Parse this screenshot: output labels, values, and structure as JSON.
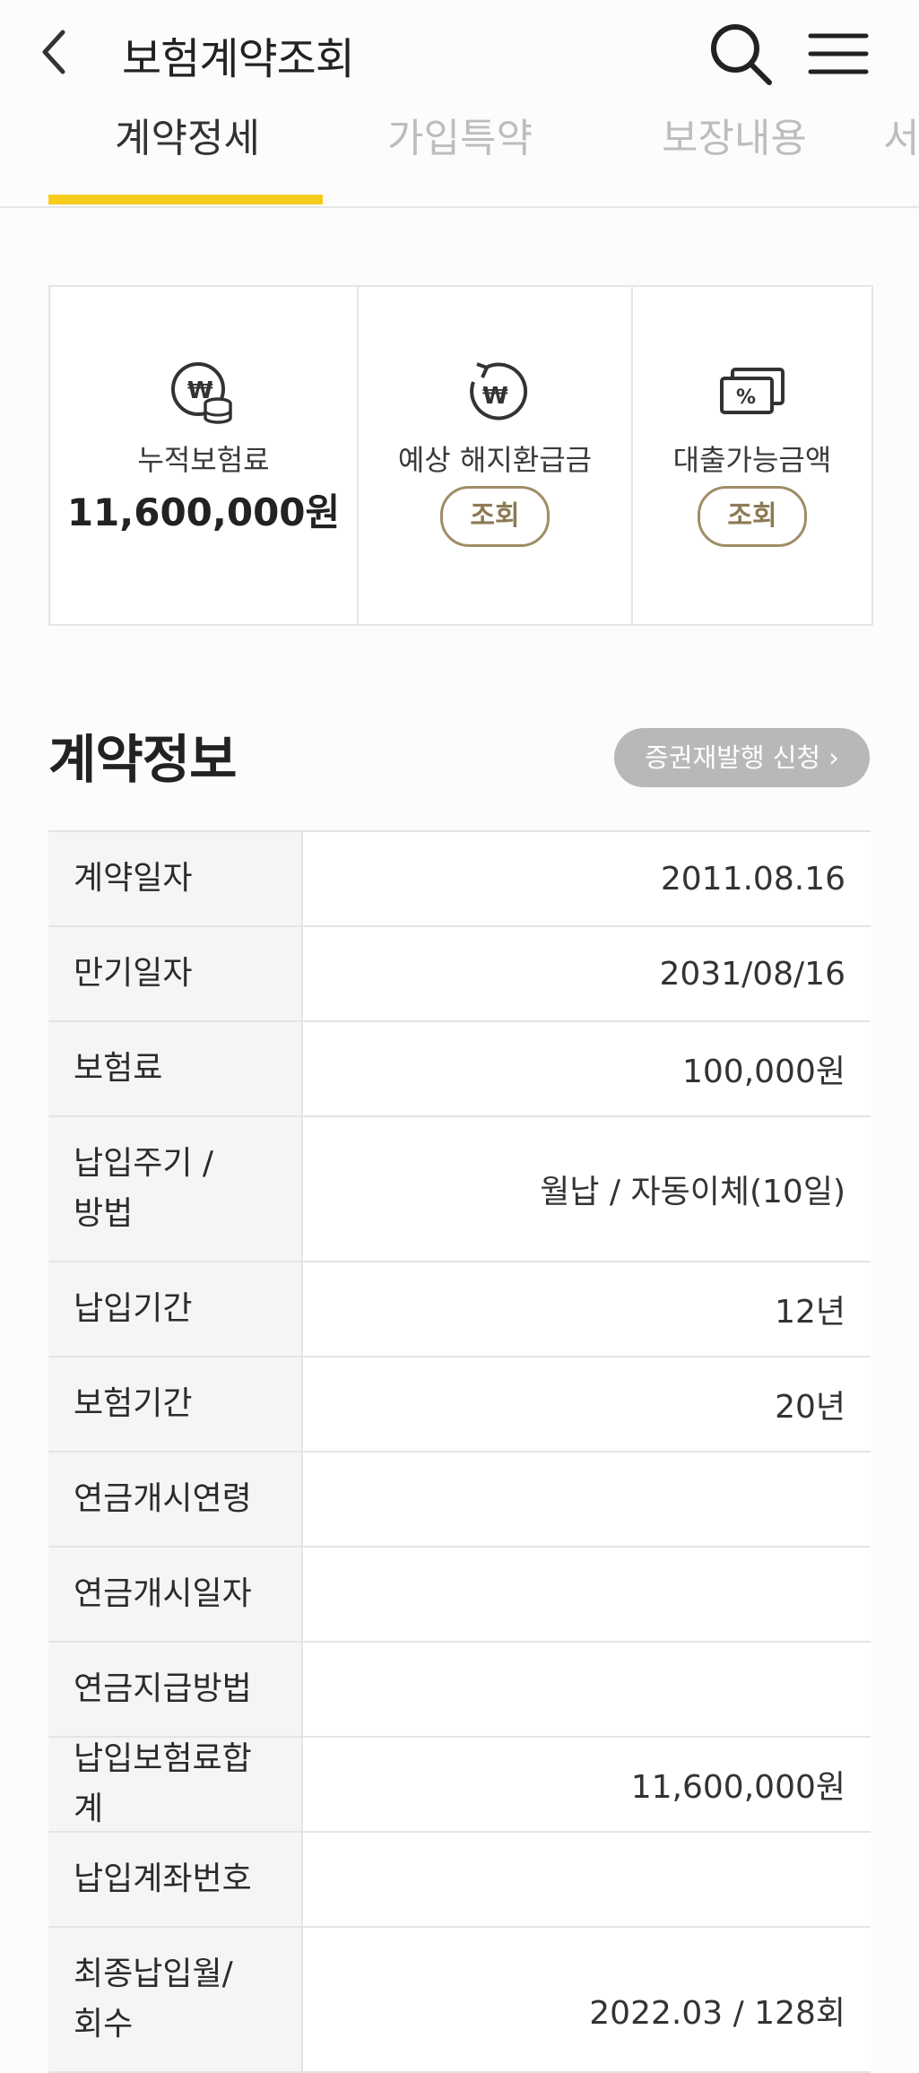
{
  "header": {
    "title": "보험계약조회"
  },
  "tabs": [
    {
      "label": "계약정세",
      "active": true
    },
    {
      "label": "가입특약",
      "active": false
    },
    {
      "label": "보장내용",
      "active": false
    },
    {
      "label": "서",
      "active": false
    }
  ],
  "summary": {
    "premium_total": {
      "label": "누적보험료",
      "value": "11,600,000원"
    },
    "refund": {
      "label": "예상 해지환급금",
      "button": "조회"
    },
    "loan": {
      "label": "대출가능금액",
      "button": "조회"
    }
  },
  "contract": {
    "title": "계약정보",
    "reissue_button": "증권재발행 신청 ›",
    "rows": [
      {
        "label": "계약일자",
        "value": "2011.08.16"
      },
      {
        "label": "만기일자",
        "value": "2031/08/16"
      },
      {
        "label": "보험료",
        "value": "100,000원"
      },
      {
        "label": "납입주기 / 방법",
        "value": "월납 / 자동이체(10일)"
      },
      {
        "label": "납입기간",
        "value": "12년"
      },
      {
        "label": "보험기간",
        "value": "20년"
      },
      {
        "label": "연금개시연령",
        "value": ""
      },
      {
        "label": "연금개시일자",
        "value": ""
      },
      {
        "label": "연금지급방법",
        "value": ""
      },
      {
        "label": "납입보험료합계",
        "value": "11,600,000원"
      },
      {
        "label": "납입계좌번호",
        "value": ""
      },
      {
        "label": "최종납입월/ 회수",
        "value": "2022.03 / 128회"
      }
    ]
  },
  "colors": {
    "accent": "#f6cd1f",
    "button_brown": "#a08d67",
    "gray_button": "#b8b8b8"
  }
}
